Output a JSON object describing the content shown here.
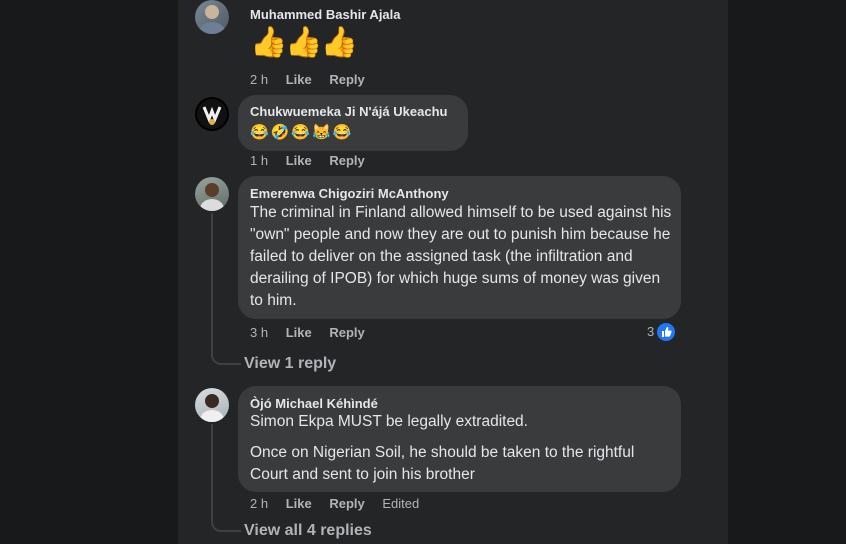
{
  "comments": [
    {
      "author": "Muhammed Bashir Ajala",
      "text": "👍👍👍",
      "time": "2 h",
      "like": "Like",
      "reply": "Reply"
    },
    {
      "author": "Chukwuemeka Ji N'ájá Ukeachu",
      "text": "😂🤣😂😹😂",
      "time": "1 h",
      "like": "Like",
      "reply": "Reply"
    },
    {
      "author": "Emerenwa Chigoziri McAnthony",
      "text": "The criminal in Finland allowed himself to be used against his \"own\" people and now they are out to punish him because he failed to deliver on the assigned task (the infiltration and derailing of IPOB) for which huge sums of money was given to him.",
      "time": "3 h",
      "like": "Like",
      "reply": "Reply",
      "reaction_count": "3",
      "replies_link": "View 1 reply"
    },
    {
      "author": "Òjó Michael Kéhìndé",
      "text1": "Simon Ekpa MUST be legally extradited.",
      "text2": "Once on Nigerian Soil, he should be taken to the rightful Court and sent to join his brother",
      "time": "2 h",
      "like": "Like",
      "reply": "Reply",
      "edited": "Edited",
      "replies_link": "View all 4 replies"
    }
  ],
  "icons": {
    "like_badge": "thumbs-up-icon"
  },
  "colors": {
    "background": "#18191a",
    "panel": "#242526",
    "bubble": "#3a3b3c",
    "text": "#e4e6eb",
    "secondary": "#b0b3b8",
    "like_blue": "#2078f4"
  }
}
